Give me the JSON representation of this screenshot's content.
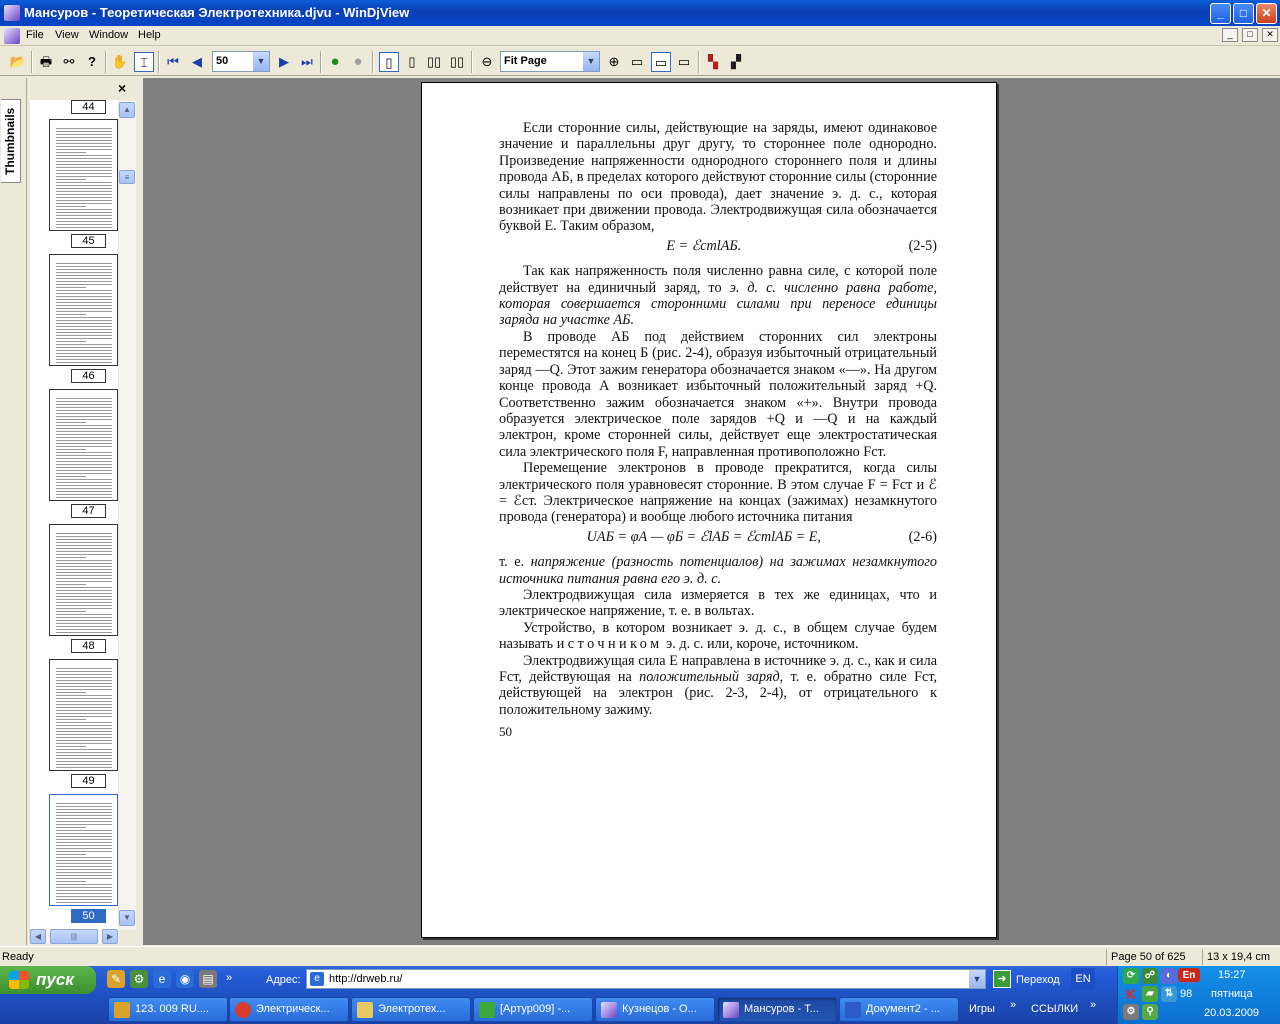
{
  "window": {
    "title": "Мансуров - Теоретическая Электротехника.djvu - WinDjView",
    "minimize": "_",
    "maximize": "□",
    "close": "✕"
  },
  "menu": {
    "items": [
      "File",
      "View",
      "Window",
      "Help"
    ],
    "mdi_buttons": [
      "_",
      "□",
      "✕"
    ]
  },
  "toolbar": {
    "page_number": "50",
    "zoom": "Fit Page"
  },
  "sidebar": {
    "tab_label": "Thumbnails",
    "close": "×",
    "pages": [
      "44",
      "45",
      "46",
      "47",
      "48",
      "49",
      "50"
    ],
    "selected_page": "50"
  },
  "document": {
    "para1": "Если сторонние силы, действующие на заряды, имеют одинаковое значение и параллельны друг другу, то стороннее поле однородно. Произведение напряженности однородного стороннего поля и длины провода АБ, в пределах которого действуют сторонние силы (сторонние силы направлены по оси провода), дает значение э. д. с., которая возникает при движении провода. Электродвижущая сила обозначается буквой Е. Таким образом,",
    "formula1": "E = ℰстlАБ.",
    "formula1_num": "(2-5)",
    "para2a": "Так как напряженность поля численно равна силе, с которой поле действует на единичный заряд, то ",
    "para2b": "э. д. с. численно равна работе, которая совершается сторонними силами при переносе единицы заряда на участке АБ.",
    "para3": "В проводе АБ под действием сторонних сил электроны переместятся на конец Б (рис. 2-4), образуя избыточный отрицательный заряд —Q. Этот зажим генератора обозначается знаком «—». На другом конце провода А возникает избыточный положительный заряд +Q. Соответственно зажим обозначается знаком «+». Внутри провода образуется электрическое поле зарядов +Q и —Q и на каждый электрон, кроме сторонней силы, действует еще электростатическая сила электрического поля F, направленная противоположно Fст.",
    "para4": "Перемещение электронов в проводе прекратится, когда силы электрического поля уравновесят сторонние. В этом случае F = Fст и ℰ = ℰст. Электрическое напряжение на концах (зажимах) незамкнутого провода (генератора) и вообще любого источника питания",
    "formula2": "UАБ = φА — φБ = ℰlАБ = ℰстlАБ = E,",
    "formula2_num": "(2-6)",
    "para5a": "т. е. ",
    "para5b": "напряжение (разность потенциалов) на зажимах незамкнутого источника питания равна его э. д. с.",
    "para6": "Электродвижущая сила измеряется в тех же единицах, что и электрическое напряжение, т. е. в вольтах.",
    "para7a": "Устройство, в котором возникает э. д. с., в общем случае будем называть ",
    "para7b": "источником",
    "para7c": " э. д. с. или, короче, источником.",
    "para8a": "Электродвижущая сила Е направлена в источнике э. д. с., как и сила Fст, действующая на ",
    "para8b": "положительный заряд",
    "para8c": ", т. е. обратно силе Fст, действующей на электрон (рис. 2-3, 2-4), от отрицательного к положительному зажиму.",
    "page_num": "50"
  },
  "status": {
    "left": "Ready",
    "page": "Page 50 of 625",
    "size": "13 x 19,4 cm"
  },
  "taskbar": {
    "start": "пуск",
    "address_label": "Адрес:",
    "address": "http://drweb.ru/",
    "go": "Переход",
    "lang": "EN",
    "tasks": [
      "123. 009 RU....",
      "Электрическ...",
      "Электротех...",
      "[Артур009] -...",
      "Кузнецов - О...",
      "Мансуров - Т...",
      "Документ2 - ..."
    ],
    "active_task": 5,
    "games": "Игры",
    "links": "ССЫЛКИ",
    "tray_num": "98",
    "time": "15:27",
    "day": "пятница",
    "date": "20.03.2009",
    "tray_en": "En"
  },
  "colors": {
    "titlebar": "#0a4fc5",
    "selection": "#316ac5",
    "workspace": "#808080",
    "taskbar": "#245edb",
    "start": "#3c8f30"
  }
}
